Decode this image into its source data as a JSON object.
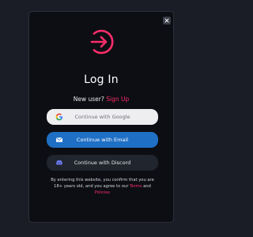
{
  "modal": {
    "title": "Log In",
    "close_icon": "close-icon",
    "logo_icon": "login-arrow-icon",
    "signup_prompt": "New user?",
    "signup_link": "Sign Up",
    "buttons": {
      "google": {
        "label": "Continue with Google",
        "icon": "google-icon"
      },
      "email": {
        "label": "Continue with Email",
        "icon": "email-icon"
      },
      "discord": {
        "label": "Continue with Discord",
        "icon": "discord-icon"
      }
    },
    "disclaimer": {
      "text": "By entering this website, you confirm that you are 18+ years old, and you agree to our",
      "terms": "Terms",
      "and": "and",
      "policies": "Policies"
    }
  },
  "colors": {
    "background": "#1a1d26",
    "modal_bg": "#0c0e14",
    "accent": "#ff2d6a",
    "email_blue": "#1f6fc5",
    "google_bg": "#eeeef1",
    "discord_bg": "#20252e"
  }
}
